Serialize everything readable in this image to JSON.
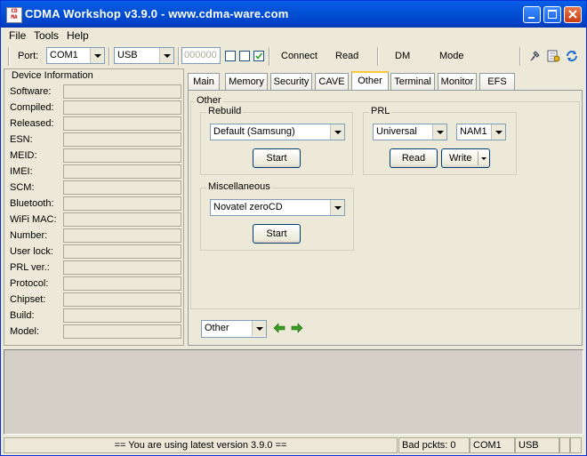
{
  "window": {
    "title": "CDMA Workshop v3.9.0   -   www.cdma-ware.com",
    "icon_text": "CDMA"
  },
  "menu": [
    "File",
    "Tools",
    "Help"
  ],
  "toolbar": {
    "port_label": "Port:",
    "port_value": "COM1",
    "interface_value": "USB",
    "spc_value": "000000",
    "connect_label": "Connect",
    "read_label": "Read",
    "dm_label": "DM",
    "mode_label": "Mode",
    "checkbox_states": [
      false,
      false,
      true
    ]
  },
  "device_info": {
    "title": "Device Information",
    "fields": [
      "Software:",
      "Compiled:",
      "Released:",
      "ESN:",
      "MEID:",
      "IMEI:",
      "SCM:",
      "Bluetooth:",
      "WiFi MAC:",
      "Number:",
      "User lock:",
      "PRL ver.:",
      "Protocol:",
      "Chipset:",
      "Build:",
      "Model:"
    ]
  },
  "tabs": [
    "Main",
    "Memory",
    "Security",
    "CAVE",
    "Other",
    "Terminal",
    "Monitor",
    "EFS"
  ],
  "active_tab": "Other",
  "other": {
    "group_title": "Other",
    "rebuild": {
      "title": "Rebuild",
      "selected": "Default (Samsung)",
      "start_label": "Start"
    },
    "prl": {
      "title": "PRL",
      "type_selected": "Universal",
      "nam_selected": "NAM1",
      "read_label": "Read",
      "write_label": "Write"
    },
    "misc": {
      "title": "Miscellaneous",
      "selected": "Novatel zeroCD",
      "start_label": "Start"
    }
  },
  "nav": {
    "selected": "Other"
  },
  "status": {
    "message": "==  You are using latest version 3.9.0  ==",
    "bad_packets": "Bad pckts: 0",
    "port": "COM1",
    "interface": "USB"
  },
  "colors": {
    "titlebar": "#0352d6",
    "face": "#ece9d8",
    "active_tab_accent": "#ffc83c",
    "arrow_green": "#3a9a22"
  }
}
